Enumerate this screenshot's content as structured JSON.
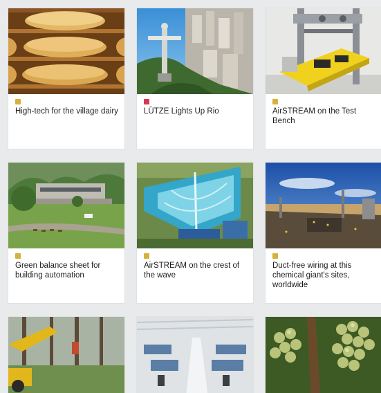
{
  "cards": [
    {
      "title": "High-tech for the village dairy",
      "tag_color": "#d7b23a"
    },
    {
      "title": "LÜTZE Lights Up Rio",
      "tag_color": "#d33a55"
    },
    {
      "title": "AirSTREAM on the Test Bench",
      "tag_color": "#d7b23a"
    },
    {
      "title": "Green balance sheet for building automation",
      "tag_color": "#d7b23a"
    },
    {
      "title": "AirSTREAM on the crest of the wave",
      "tag_color": "#d7b23a"
    },
    {
      "title": "Duct-free wiring at this chemical giant's sites, worldwide",
      "tag_color": "#d7b23a"
    }
  ]
}
